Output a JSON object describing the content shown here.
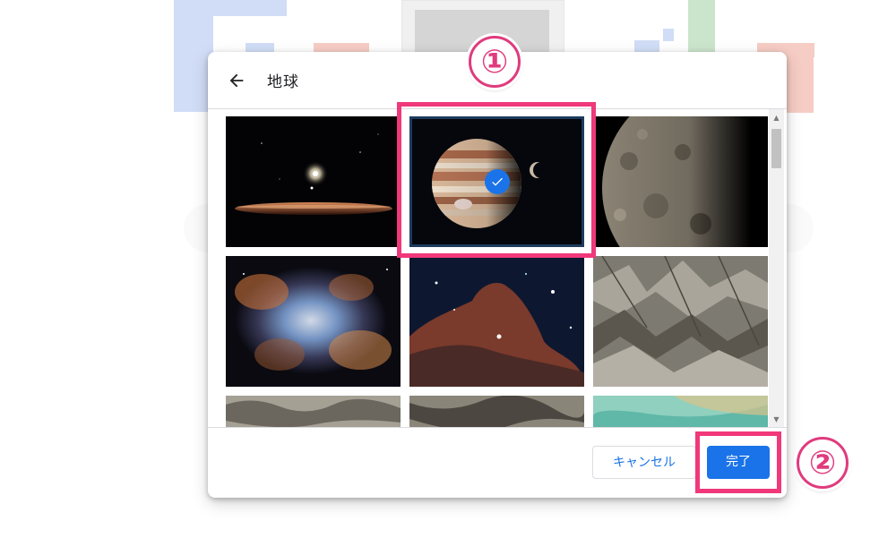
{
  "dialog": {
    "title": "地球",
    "cancel_label": "キャンセル",
    "done_label": "完了"
  },
  "tiles": [
    {
      "name": "wallpaper-planet-horizon",
      "selected": false
    },
    {
      "name": "wallpaper-jupiter-moon",
      "selected": true
    },
    {
      "name": "wallpaper-cratered-moon",
      "selected": false
    },
    {
      "name": "wallpaper-nebula",
      "selected": false
    },
    {
      "name": "wallpaper-horsehead-nebula",
      "selected": false
    },
    {
      "name": "wallpaper-mountain-terrain",
      "selected": false
    },
    {
      "name": "wallpaper-terrain-aerial-1",
      "selected": false
    },
    {
      "name": "wallpaper-terrain-aerial-2",
      "selected": false
    },
    {
      "name": "wallpaper-coastline-aerial",
      "selected": false
    }
  ],
  "annotations": {
    "step1": "①",
    "step2": "②"
  },
  "colors": {
    "accent": "#1a73e8",
    "highlight": "#f0387a"
  },
  "icons": {
    "back": "arrow-back-icon",
    "check": "check-icon"
  }
}
